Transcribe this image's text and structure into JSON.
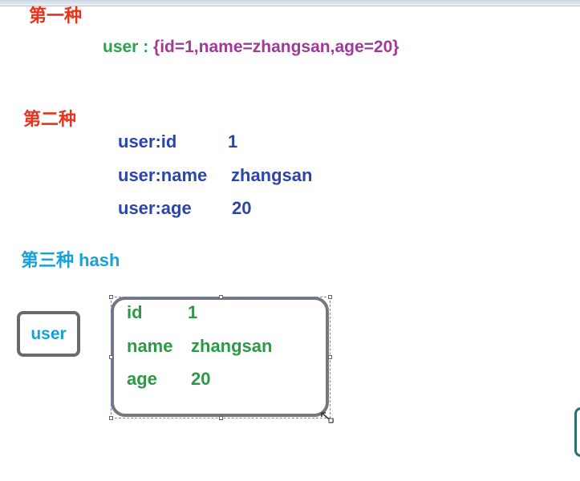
{
  "section1": {
    "heading": "第一种",
    "key": "user : ",
    "value": "{id=1,name=zhangsan,age=20}"
  },
  "section2": {
    "heading": "第二种",
    "rows": [
      {
        "key": "user:id",
        "value": "1"
      },
      {
        "key": "user:name",
        "value": "zhangsan"
      },
      {
        "key": "user:age",
        "value": "20"
      }
    ]
  },
  "section3": {
    "heading": "第三种  hash",
    "user_label": "user",
    "fields": [
      {
        "field": "id",
        "value": "1"
      },
      {
        "field": "name",
        "value": "zhangsan"
      },
      {
        "field": "age",
        "value": "20"
      }
    ]
  },
  "colors": {
    "heading_red": "#e8331c",
    "key_green": "#2aa14a",
    "value_purple": "#a0399a",
    "list_blue": "#2d45a8",
    "hash_cyan": "#1aa0d8",
    "hash_green": "#2b9a45"
  }
}
